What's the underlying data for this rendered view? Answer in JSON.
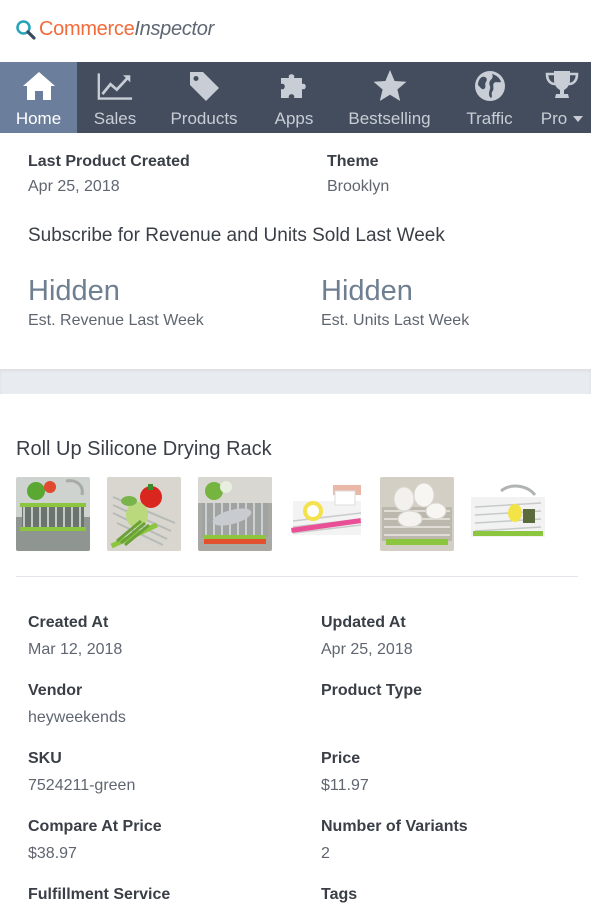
{
  "logo": {
    "commerce": "Commerce",
    "inspector": "Inspector"
  },
  "nav": [
    {
      "label": "Home",
      "icon": "home-icon",
      "active": true
    },
    {
      "label": "Sales",
      "icon": "chart-icon"
    },
    {
      "label": "Products",
      "icon": "tag-icon"
    },
    {
      "label": "Apps",
      "icon": "puzzle-icon"
    },
    {
      "label": "Bestselling",
      "icon": "star-icon"
    },
    {
      "label": "Traffic",
      "icon": "globe-icon"
    },
    {
      "label": "Pro",
      "icon": "trophy-icon"
    }
  ],
  "store": {
    "last_product_label": "Last Product Created",
    "last_product_value": "Apr 25, 2018",
    "theme_label": "Theme",
    "theme_value": "Brooklyn",
    "subscribe_text": "Subscribe for Revenue and Units Sold Last Week",
    "revenue_value": "Hidden",
    "revenue_caption": "Est. Revenue Last Week",
    "units_value": "Hidden",
    "units_caption": "Est. Units Last Week"
  },
  "product": {
    "title": "Roll Up Silicone Drying Rack",
    "fields": [
      {
        "label": "Created At",
        "value": "Mar 12, 2018"
      },
      {
        "label": "Updated At",
        "value": "Apr 25, 2018"
      },
      {
        "label": "Vendor",
        "value": "heyweekends"
      },
      {
        "label": "Product Type",
        "value": ""
      },
      {
        "label": "SKU",
        "value": "7524211-green"
      },
      {
        "label": "Price",
        "value": "$11.97"
      },
      {
        "label": "Compare At Price",
        "value": "$38.97"
      },
      {
        "label": "Number of Variants",
        "value": "2"
      },
      {
        "label": "Fulfillment Service",
        "value": ""
      },
      {
        "label": "Tags",
        "value": ""
      }
    ]
  },
  "colors": {
    "brand_orange": "#f26b3a",
    "nav_bg": "#434d5e",
    "nav_active": "#6b7e9b",
    "hidden_value": "#6e7f91"
  }
}
